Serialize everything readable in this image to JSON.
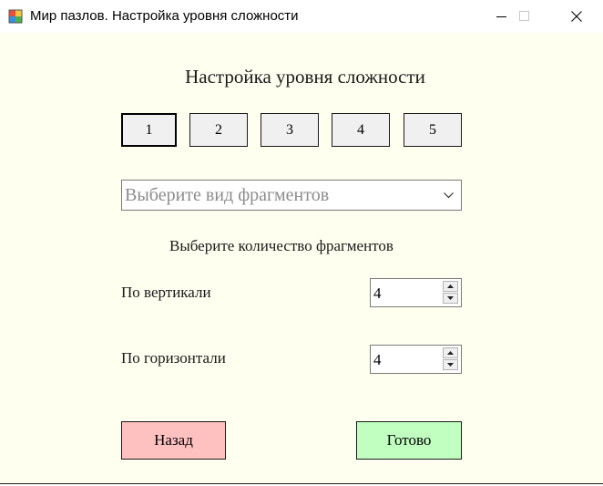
{
  "window": {
    "title": "Мир пазлов. Настройка уровня сложности",
    "icons": {
      "app": "puzzle-app-icon",
      "minimize": "minimize-icon",
      "maximize": "maximize-icon",
      "close": "close-icon"
    }
  },
  "form": {
    "heading": "Настройка уровня сложности",
    "levels": [
      {
        "label": "1",
        "selected": true
      },
      {
        "label": "2",
        "selected": false
      },
      {
        "label": "3",
        "selected": false
      },
      {
        "label": "4",
        "selected": false
      },
      {
        "label": "5",
        "selected": false
      }
    ],
    "fragment_type": {
      "placeholder": "Выберите вид фрагментов",
      "icon": "chevron-down-icon"
    },
    "count_label": "Выберите количество фрагментов",
    "vertical": {
      "label": "По вертикали",
      "value": "4"
    },
    "horizontal": {
      "label": "По горизонтали",
      "value": "4"
    },
    "back_button": {
      "label": "Назад",
      "color": "#ffc0c0"
    },
    "done_button": {
      "label": "Готово",
      "color": "#c0ffc0"
    }
  },
  "colors": {
    "background": "#fffff0",
    "titlebar": "#ffffff",
    "level_button": "#f0f0f0"
  }
}
